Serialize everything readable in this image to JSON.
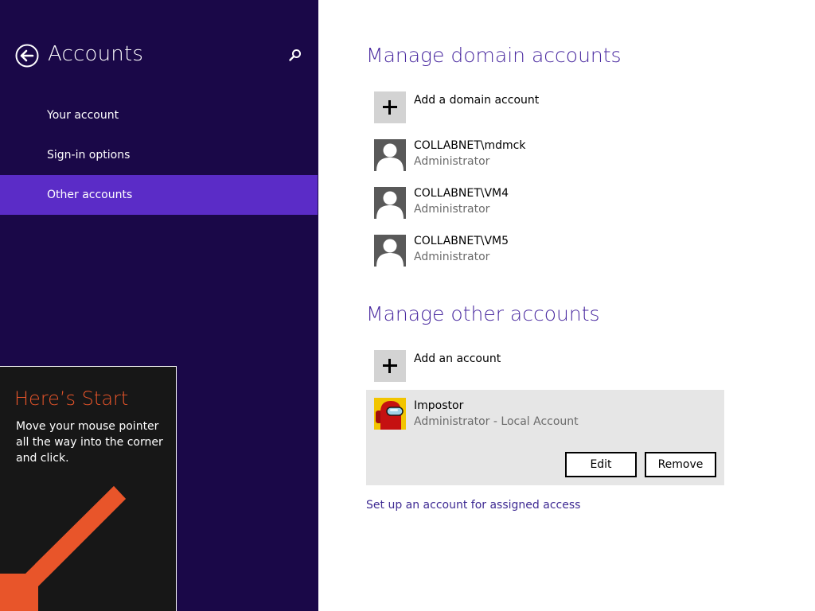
{
  "sidebar": {
    "title": "Accounts",
    "items": [
      {
        "label": "Your account",
        "active": false
      },
      {
        "label": "Sign-in options",
        "active": false
      },
      {
        "label": "Other accounts",
        "active": true
      }
    ]
  },
  "start_tip": {
    "title": "Here’s Start",
    "text": "Move your mouse pointer all the way into the corner and click."
  },
  "domain_section": {
    "title": "Manage domain accounts",
    "add_label": "Add a domain account",
    "accounts": [
      {
        "name": "COLLABNET\\mdmck",
        "role": "Administrator"
      },
      {
        "name": "COLLABNET\\VM4",
        "role": "Administrator"
      },
      {
        "name": "COLLABNET\\VM5",
        "role": "Administrator"
      }
    ]
  },
  "other_section": {
    "title": "Manage other accounts",
    "add_label": "Add an account",
    "selected_account": {
      "name": "Impostor",
      "role": "Administrator - Local Account",
      "edit_label": "Edit",
      "remove_label": "Remove"
    }
  },
  "assigned_access_link": "Set up an account for assigned access",
  "icons": {
    "back": "back-arrow-icon",
    "search": "search-icon",
    "plus": "plus-icon",
    "user": "user-silhouette-icon",
    "impostor": "red-crewmate-avatar",
    "start_arrow": "diagonal-arrow-icon"
  },
  "colors": {
    "sidebar_bg": "#1a0848",
    "sidebar_active": "#5b2cc7",
    "section_title": "#4a2aa0",
    "start_accent": "#e8552a",
    "selected_bg": "#e6e6e6"
  }
}
